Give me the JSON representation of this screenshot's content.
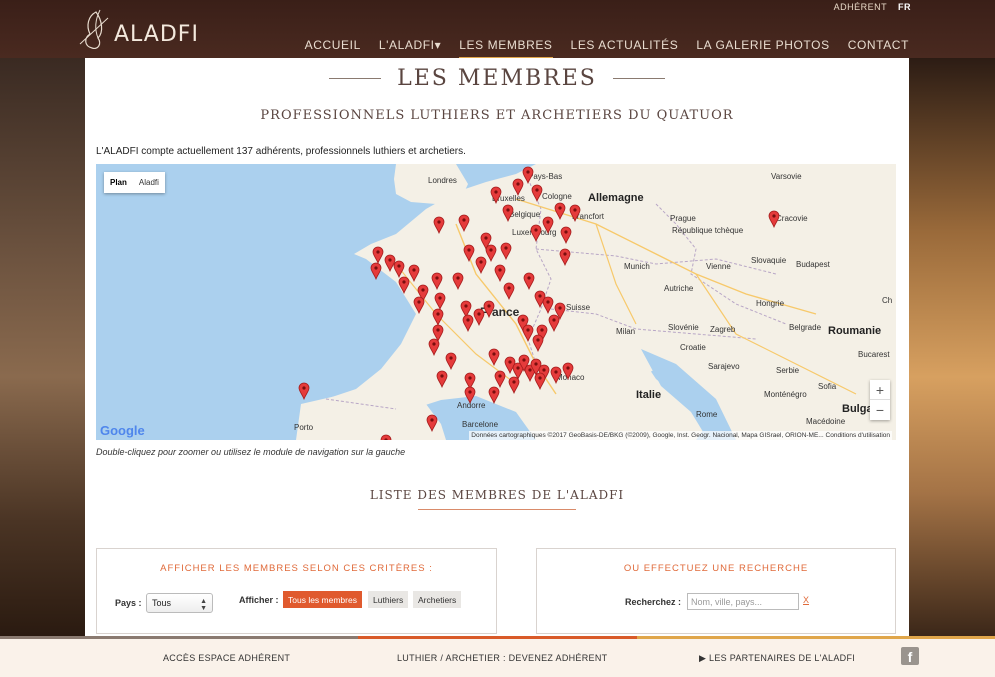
{
  "header": {
    "logo_text": "ALADFI",
    "util_links": [
      "ADHÉRENT",
      "FR"
    ],
    "nav": [
      {
        "label": "ACCUEIL",
        "active": false
      },
      {
        "label": "L'ALADFI▾",
        "active": false
      },
      {
        "label": "LES MEMBRES",
        "active": true
      },
      {
        "label": "LES ACTUALITÉS",
        "active": false
      },
      {
        "label": "LA GALERIE PHOTOS",
        "active": false
      },
      {
        "label": "CONTACT",
        "active": false
      }
    ]
  },
  "main": {
    "title": "Les membres",
    "subtitle": "Professionnels luthiers et archetiers du quatuor",
    "intro": "L'ALADFI compte actuellement 137 adhérents, professionnels luthiers et archetiers.",
    "hint": "Double-cliquez pour zoomer ou utilisez le module de navigation sur la gauche",
    "list_title": "Liste des membres de l'ALADFI"
  },
  "map": {
    "type_buttons": [
      "Plan",
      "Aladfi"
    ],
    "zoom_in": "+",
    "zoom_out": "−",
    "google": "Google",
    "attribution": "Données cartographiques ©2017 GeoBasis-DE/BKG (©2009), Google, Inst. Geogr. Nacional, Mapa GISrael, ORION-ME... Conditions d'utilisation",
    "labels": [
      {
        "text": "Pays-Bas",
        "kind": "small"
      },
      {
        "text": "Londres",
        "kind": "small"
      },
      {
        "text": "Allemagne",
        "kind": "big"
      },
      {
        "text": "Varsovie",
        "kind": "small"
      },
      {
        "text": "Cologne",
        "kind": "small"
      },
      {
        "text": "Bruxelles",
        "kind": "small"
      },
      {
        "text": "Belgique",
        "kind": "small"
      },
      {
        "text": "Francfort",
        "kind": "small"
      },
      {
        "text": "Prague",
        "kind": "small"
      },
      {
        "text": "Cracovie",
        "kind": "small"
      },
      {
        "text": "Luxembourg",
        "kind": "small"
      },
      {
        "text": "République tchèque",
        "kind": "small"
      },
      {
        "text": "Slovaquie",
        "kind": "small"
      },
      {
        "text": "Munich",
        "kind": "small"
      },
      {
        "text": "Vienne",
        "kind": "small"
      },
      {
        "text": "Budapest",
        "kind": "small"
      },
      {
        "text": "Autriche",
        "kind": "small"
      },
      {
        "text": "Hongrie",
        "kind": "small"
      },
      {
        "text": "Suisse",
        "kind": "small"
      },
      {
        "text": "Slovénie",
        "kind": "small"
      },
      {
        "text": "Zagreb",
        "kind": "small"
      },
      {
        "text": "Belgrade",
        "kind": "small"
      },
      {
        "text": "Roumanie",
        "kind": "big"
      },
      {
        "text": "Milan",
        "kind": "small"
      },
      {
        "text": "Croatie",
        "kind": "small"
      },
      {
        "text": "Bucarest",
        "kind": "small"
      },
      {
        "text": "Sarajevo",
        "kind": "small"
      },
      {
        "text": "Serbie",
        "kind": "small"
      },
      {
        "text": "France",
        "kind": "country"
      },
      {
        "text": "Monaco",
        "kind": "small"
      },
      {
        "text": "Italie",
        "kind": "big"
      },
      {
        "text": "Sofia",
        "kind": "small"
      },
      {
        "text": "Monténégro",
        "kind": "small"
      },
      {
        "text": "Bulga",
        "kind": "big"
      },
      {
        "text": "Andorre",
        "kind": "small"
      },
      {
        "text": "Rome",
        "kind": "small"
      },
      {
        "text": "Macédoine",
        "kind": "small"
      },
      {
        "text": "Porto",
        "kind": "small"
      },
      {
        "text": "Barcelone",
        "kind": "small"
      },
      {
        "text": "Ch",
        "kind": "small"
      }
    ]
  },
  "filters": {
    "title": "Afficher les membres selon ces critères :",
    "country_label": "Pays :",
    "country_value": "Tous",
    "show_label": "Afficher :",
    "buttons": [
      "Tous les membres",
      "Luthiers",
      "Archetiers"
    ]
  },
  "search": {
    "title": "Ou effectuez une recherche",
    "label": "Recherchez :",
    "placeholder": "Nom, ville, pays...",
    "clear": "X"
  },
  "footer": {
    "links": [
      "ACCÈS ESPACE ADHÉRENT",
      "LUTHIER / ARCHETIER : DEVENEZ ADHÉRENT",
      "▶ LES PARTENAIRES DE L'ALADFI"
    ],
    "facebook": "f"
  },
  "colors": {
    "accent": "#e05a2e",
    "nav_underline": "#e0a64a",
    "header": "#3a1f18",
    "pin": "#e53b3b"
  }
}
